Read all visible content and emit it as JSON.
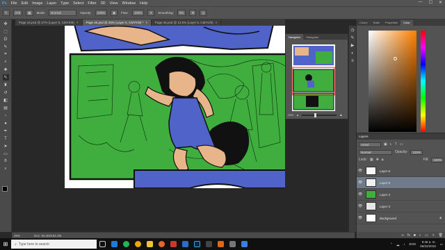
{
  "menu": [
    "Ps",
    "File",
    "Edit",
    "Image",
    "Layer",
    "Type",
    "Select",
    "Filter",
    "3D",
    "View",
    "Window",
    "Help"
  ],
  "window_controls": [
    "—",
    "☐",
    "✕"
  ],
  "options_bar": {
    "brush_size": "275",
    "mode_label": "Mode:",
    "mode_value": "Normal",
    "opacity_label": "Opacity:",
    "opacity_value": "100%",
    "flow_label": "Flow:",
    "flow_value": "100%",
    "smoothing_label": "Smoothing:",
    "smoothing_value": "0%"
  },
  "tabs": [
    {
      "label": "Page 44.psd @ 27% (Layer 5, CMYK/8)",
      "close": "×",
      "active": false
    },
    {
      "label": "Page 45.psd @ 25% (Layer 5, CMYK/8) *",
      "close": "×",
      "active": true
    },
    {
      "label": "Page 46.psd @ 12.5% (Layer 5, CMYK/8)",
      "close": "×",
      "active": false
    }
  ],
  "tools": [
    "move-icon",
    "marquee-icon",
    "lasso-icon",
    "quick-select-icon",
    "crop-icon",
    "eyedropper-icon",
    "healing-icon",
    "brush-icon",
    "stamp-icon",
    "history-brush-icon",
    "eraser-icon",
    "gradient-icon",
    "blur-icon",
    "dodge-icon",
    "pen-icon",
    "type-icon",
    "path-select-icon",
    "shape-icon",
    "hand-icon",
    "zoom-icon"
  ],
  "colors": {
    "foreground": "#000000",
    "background": "#f4f4f4",
    "panel_green": "#3fae3f",
    "skin": "#e8b48a",
    "dress": "#4f63c8"
  },
  "navigator": {
    "tabs": [
      "Navigator",
      "Histogram"
    ],
    "zoom": "25%"
  },
  "color_panel": {
    "tabs": [
      "Colors",
      "Ratio",
      "Properties",
      "Color"
    ]
  },
  "layers": {
    "title": "Layers",
    "filter_kind": "Kind",
    "blend": "Normal",
    "opacity_label": "Opacity:",
    "opacity": "100%",
    "lock_label": "Lock:",
    "fill_label": "Fill:",
    "fill": "100%",
    "items": [
      {
        "name": "Layer 6",
        "selected": false
      },
      {
        "name": "Layer 5",
        "selected": true
      },
      {
        "name": "Layer 4",
        "selected": false
      },
      {
        "name": "Layer 3",
        "selected": false
      },
      {
        "name": "Background",
        "selected": false
      }
    ]
  },
  "status": {
    "zoom": "25%",
    "doc": "Doc: 50.4M/194.2M"
  },
  "taskbar": {
    "search_placeholder": "Type here to search",
    "time": "9:48 a. m.",
    "date": "06/22/2018",
    "lang": "ENG"
  }
}
